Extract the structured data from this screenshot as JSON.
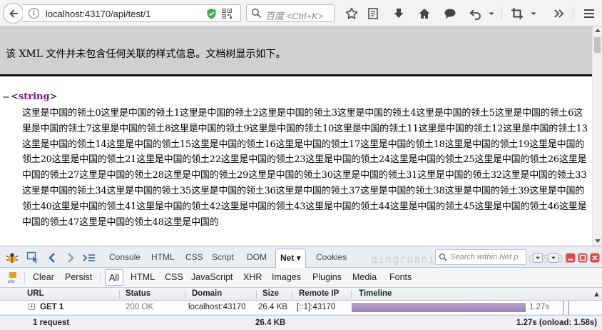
{
  "browser": {
    "url": "localhost:43170/api/test/1",
    "search_placeholder": "百度 <Ctrl+K>",
    "icons": [
      "back-arrow-icon",
      "info-icon",
      "shield-icon",
      "qr-code-icon",
      "reload-icon",
      "search-icon",
      "bookmark-star-icon",
      "reading-list-icon",
      "download-icon",
      "home-icon",
      "chat-icon",
      "undo-icon",
      "dropdown-icon",
      "crop-icon",
      "dropdown-icon",
      "overflow-icon",
      "hamburger-menu-icon"
    ]
  },
  "xml_view": {
    "info_text": "该 XML 文件并未包含任何关联的样式信息。文档树显示如下。",
    "collapse_symbol": "−",
    "tag_open": "<",
    "tag_name": "string",
    "tag_close": ">",
    "content": "这里是中国的领土0这里是中国的领土1这里是中国的领土2这里是中国的领土3这里是中国的领土4这里是中国的领土5这里是中国的领土6这里是中国的领土7这里是中国的领土8这里是中国的领土9这里是中国的领土10这里是中国的领土11这里是中国的领土12这里是中国的领土13这里是中国的领土14这里是中国的领土15这里是中国的领土16这里是中国的领土17这里是中国的领土18这里是中国的领土19这里是中国的领土20这里是中国的领土21这里是中国的领土22这里是中国的领土23这里是中国的领土24这里是中国的领土25这里是中国的领土26这里是中国的领土27这里是中国的领土28这里是中国的领土29这里是中国的领土30这里是中国的领土31这里是中国的领土32这里是中国的领土33这里是中国的领土34这里是中国的领土35这里是中国的领土36这里是中国的领土37这里是中国的领土38这里是中国的领土39这里是中国的领土40这里是中国的领土41这里是中国的领土42这里是中国的领土43这里是中国的领土44这里是中国的领土45这里是中国的领土46这里是中国的领土47这里是中国的领土48这里是中国的"
  },
  "firebug": {
    "tabs": [
      "Console",
      "HTML",
      "CSS",
      "Script",
      "DOM",
      "Net",
      "Cookies"
    ],
    "active_tab": "Net",
    "active_tab_arrow": "▾",
    "search_placeholder": "Search within Net p",
    "watermark": "qingruanit.net 0532-85025005",
    "filters": [
      "Clear",
      "Persist",
      "All",
      "HTML",
      "CSS",
      "JavaScript",
      "XHR",
      "Images",
      "Plugins",
      "Media",
      "Fonts"
    ],
    "active_filter": "All",
    "columns": [
      "URL",
      "Status",
      "Domain",
      "Size",
      "Remote IP",
      "Timeline"
    ],
    "requests": [
      {
        "url": "GET 1",
        "status": "200 OK",
        "domain": "localhost:43170",
        "size": "26.4 KB",
        "remote_ip": "[::1]:43170",
        "time": "1.27s",
        "timeline_fraction": 0.8
      }
    ],
    "summary": {
      "count": "1 request",
      "size": "26.4 KB",
      "timing": "1.27s (onload: 1.58s)"
    },
    "colors": {
      "timeline_bar": "#a892c0",
      "onload_line": "#e06060",
      "domcontent_line": "#5a7fd4"
    }
  }
}
